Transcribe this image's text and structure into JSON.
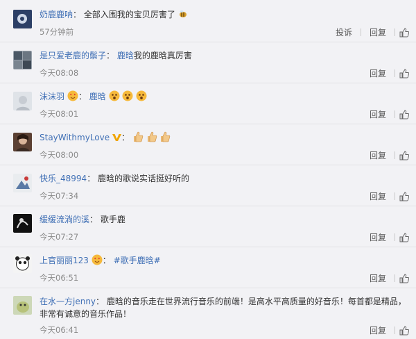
{
  "comments": [
    {
      "user": "奶鹿鹿呐",
      "segments": [
        "全部入围我的宝贝厉害了"
      ],
      "time": "57分钟前",
      "report": "投诉",
      "reply": "回复"
    },
    {
      "user": "是只爱老鹿的鬃子",
      "mention": "鹿晗",
      "text": "我的鹿晗真厉害",
      "time": "今天08:08",
      "reply": "回复"
    },
    {
      "user": "沫沫羽",
      "mention": "鹿晗",
      "time": "今天08:01",
      "reply": "回复"
    },
    {
      "user": "StayWithmyLove",
      "time": "今天08:00",
      "reply": "回复"
    },
    {
      "user": "快乐_48994",
      "text": "鹿晗的歌说实话挺好听的",
      "time": "今天07:34",
      "reply": "回复"
    },
    {
      "user": "缓缓流淌的溪",
      "text": "歌手鹿",
      "time": "今天07:27",
      "reply": "回复"
    },
    {
      "user": "上官丽丽123",
      "hashtag": "#歌手鹿晗#",
      "time": "今天06:51",
      "reply": "回复"
    },
    {
      "user": "在水一方jenny",
      "text": "鹿晗的音乐走在世界流行音乐的前端！是高水平高质量的好音乐！每首都是精品，非常有诚意的音乐作品！",
      "time": "今天06:41",
      "reply": "回复"
    }
  ],
  "icons": {
    "like": "thumb-up-icon",
    "verified": "v-badge-icon",
    "emoji_surprise": "surprised-face-emoji",
    "emoji_thumb": "thumbs-up-emoji",
    "emoji_love": "heart-eyes-emoji",
    "emoji_bee": "bee-emoji"
  },
  "colors": {
    "username": "#3f6fb5",
    "meta": "#8a8a8a",
    "background": "#f2f2f5",
    "vbadge": "#f0a500"
  }
}
